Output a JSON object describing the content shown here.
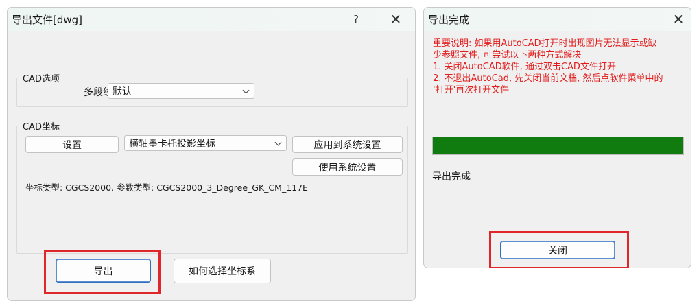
{
  "export_dialog": {
    "title": "导出文件[dwg]",
    "help_glyph": "?",
    "close_glyph": "✕",
    "cad_options": {
      "legend": "CAD选项",
      "polyline_label": "多段线",
      "polyline_value": "默认"
    },
    "cad_coords": {
      "legend": "CAD坐标",
      "settings_button": "设置",
      "projection_value": "横轴墨卡托投影坐标",
      "apply_system_button": "应用到系统设置",
      "use_system_button": "使用系统设置",
      "coord_info": "坐标类型: CGCS2000, 参数类型: CGCS2000_3_Degree_GK_CM_117E"
    },
    "export_button": "导出",
    "how_choose_button": "如何选择坐标系"
  },
  "complete_dialog": {
    "title": "导出完成",
    "close_glyph": "✕",
    "notice_lines": [
      "重要说明: 如果用AutoCAD打开时出现图片无法显示或缺",
      "少参照文件, 可尝试以下两种方式解决",
      "1. 关闭AutoCAD软件, 通过双击CAD文件打开",
      "2. 不退出AutoCad, 先关闭当前文档, 然后点软件菜单中的",
      "'打开'再次打开文件"
    ],
    "progress": 1.0,
    "status_text": "导出完成",
    "close_button": "关闭"
  },
  "colors": {
    "highlight": "#e0262b",
    "notice_text": "#e21b1b",
    "progress_fill": "#107c10"
  }
}
